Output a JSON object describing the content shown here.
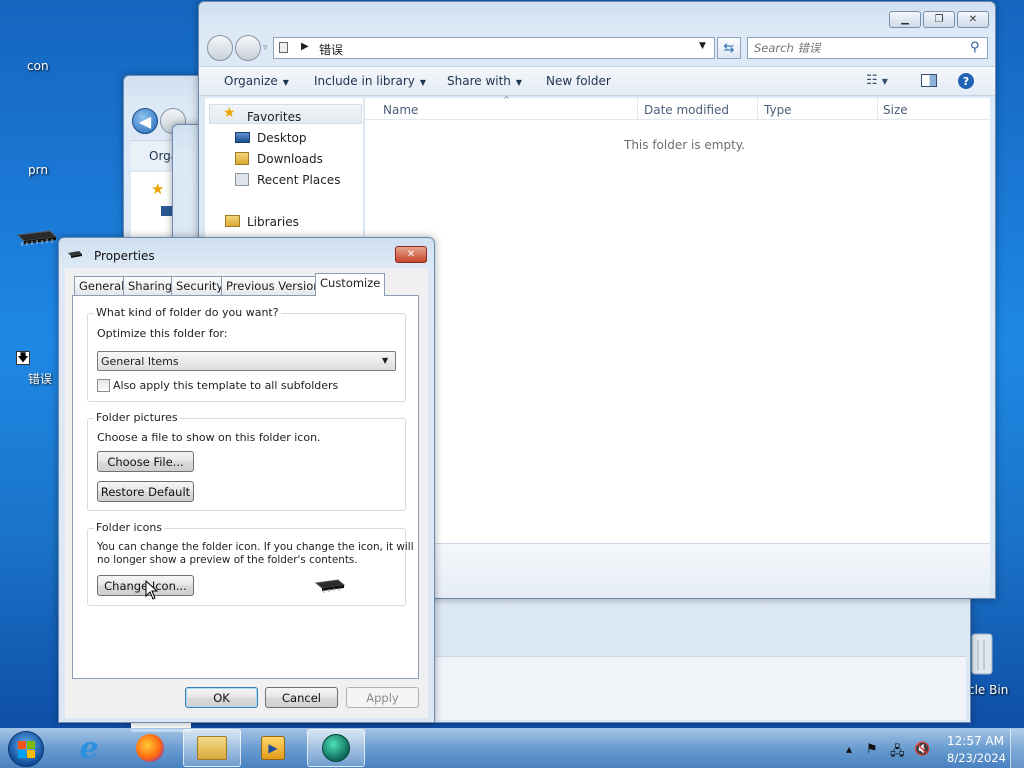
{
  "desktop": {
    "icons": [
      {
        "label": "con"
      },
      {
        "label": "prn"
      },
      {
        "label": "错误"
      },
      {
        "label": "cle Bin"
      }
    ]
  },
  "explorer": {
    "address": "错误",
    "search_placeholder": "Search 错误",
    "toolbar": {
      "organize": "Organize",
      "include_in_library": "Include in library",
      "share_with": "Share with",
      "new_folder": "New folder"
    },
    "nav": {
      "favorites": "Favorites",
      "desktop": "Desktop",
      "downloads": "Downloads",
      "recent_places": "Recent Places",
      "libraries": "Libraries"
    },
    "columns": [
      "Name",
      "Date modified",
      "Type",
      "Size"
    ],
    "empty_message": "This folder is empty."
  },
  "background_window": {
    "toolbar_fragment": "Orga"
  },
  "dialog": {
    "title": "Properties",
    "tabs": [
      "General",
      "Sharing",
      "Security",
      "Previous Versions",
      "Customize"
    ],
    "active_tab": "Customize",
    "kind_group": {
      "title": "What kind of folder do you want?",
      "optimize_label": "Optimize this folder for:",
      "optimize_value": "General Items",
      "apply_checkbox_label": "Also apply this template to all subfolders",
      "apply_checked": false
    },
    "pictures_group": {
      "title": "Folder pictures",
      "description": "Choose a file to show on this folder icon.",
      "choose_file": "Choose File...",
      "restore_default": "Restore Default"
    },
    "icons_group": {
      "title": "Folder icons",
      "description_line1": "You can change the folder icon. If you change the icon, it will",
      "description_line2": "no longer show a preview of the folder's contents.",
      "change_icon": "Change Icon..."
    },
    "buttons": {
      "ok": "OK",
      "cancel": "Cancel",
      "apply": "Apply"
    }
  },
  "taskbar": {
    "time": "12:57 AM",
    "date": "8/23/2024"
  },
  "colors": {
    "desktop": "#1e88e5",
    "taskbar": "#78aad7",
    "close_button": "#c6442b"
  }
}
